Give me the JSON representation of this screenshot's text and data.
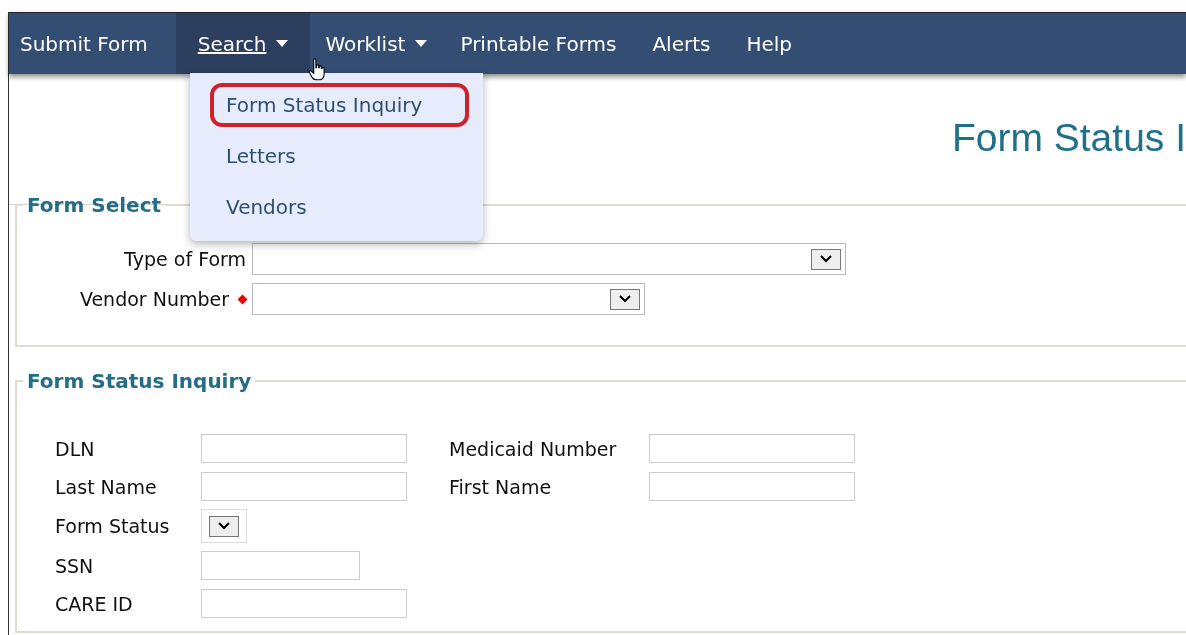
{
  "nav": {
    "items": [
      {
        "label": "Submit Form",
        "has_menu": false,
        "selected": false
      },
      {
        "label": "Search",
        "has_menu": true,
        "selected": true
      },
      {
        "label": "Worklist",
        "has_menu": true,
        "selected": false
      },
      {
        "label": "Printable Forms",
        "has_menu": false,
        "selected": false
      },
      {
        "label": "Alerts",
        "has_menu": false,
        "selected": false
      },
      {
        "label": "Help",
        "has_menu": false,
        "selected": false
      }
    ]
  },
  "dropdown": {
    "items": [
      {
        "label": "Form Status Inquiry",
        "highlighted": true
      },
      {
        "label": "Letters",
        "highlighted": false
      },
      {
        "label": "Vendors",
        "highlighted": false
      }
    ]
  },
  "page_title": "Form Status I",
  "form_select": {
    "legend": "Form Select",
    "fields": [
      {
        "label": "Type of Form",
        "kind": "select",
        "required": false
      },
      {
        "label": "Vendor Number",
        "kind": "select",
        "required": true
      }
    ]
  },
  "form_status_inquiry": {
    "legend": "Form Status Inquiry",
    "left_fields": [
      {
        "label": "DLN",
        "kind": "text"
      },
      {
        "label": "Last Name",
        "kind": "text"
      },
      {
        "label": "Form Status",
        "kind": "select"
      },
      {
        "label": "SSN",
        "kind": "text"
      },
      {
        "label": "CARE ID",
        "kind": "text"
      }
    ],
    "right_fields": [
      {
        "label": "Medicaid Number",
        "kind": "text"
      },
      {
        "label": "First Name",
        "kind": "text"
      }
    ]
  }
}
